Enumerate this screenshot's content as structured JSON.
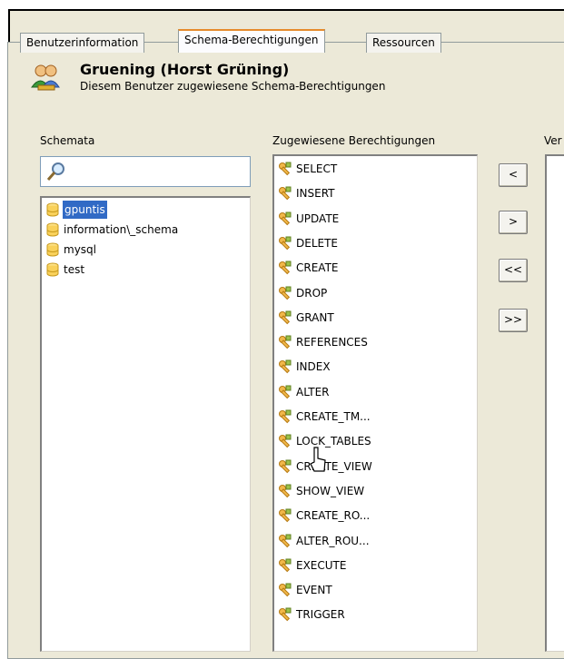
{
  "tabs": [
    {
      "label": "Benutzerinformation"
    },
    {
      "label": "Schema-Berechtigungen"
    },
    {
      "label": "Ressourcen"
    }
  ],
  "header": {
    "title": "Gruening (Horst Grüning)",
    "subtitle": "Diesem Benutzer zugewiesene Schema-Berechtigungen"
  },
  "schemata": {
    "label": "Schemata",
    "search_value": "",
    "items": [
      "gpuntis",
      "information\\_schema",
      "mysql",
      "test"
    ]
  },
  "assigned": {
    "label": "Zugewiesene Berechtigungen",
    "items": [
      "SELECT",
      "INSERT",
      "UPDATE",
      "DELETE",
      "CREATE",
      "DROP",
      "GRANT",
      "REFERENCES",
      "INDEX",
      "ALTER",
      "CREATE_TM...",
      "LOCK_TABLES",
      "CREATE_VIEW",
      "SHOW_VIEW",
      "CREATE_RO...",
      "ALTER_ROU...",
      "EXECUTE",
      "EVENT",
      "TRIGGER"
    ]
  },
  "buttons": {
    "remove": "<",
    "add": ">",
    "remove_all": "<<",
    "add_all": ">>"
  },
  "available": {
    "label": "Ver"
  },
  "colors": {
    "selection": "#316ac5",
    "tab_highlight": "#e68b2c",
    "panel": "#ece9d8"
  }
}
